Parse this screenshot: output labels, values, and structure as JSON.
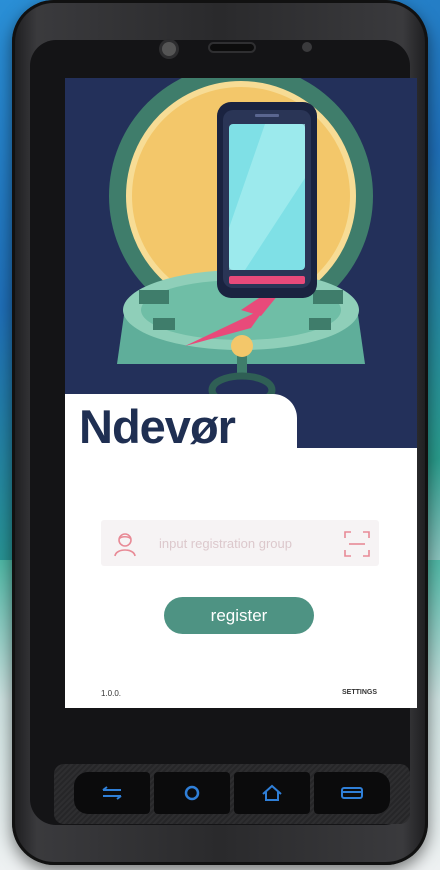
{
  "app": {
    "logo_text": "Ndevor",
    "logo_part1": "Ndev",
    "logo_part2": "ø",
    "logo_part3": "r"
  },
  "registration": {
    "placeholder": "input registration group",
    "value": ""
  },
  "buttons": {
    "register_label": "register"
  },
  "footer": {
    "version": "1.0.0.",
    "settings_label": "SETTINGS"
  },
  "navigation": {
    "buttons": [
      "switch-apps",
      "home-circle",
      "home",
      "menu"
    ]
  },
  "colors": {
    "brand_navy": "#1f2f52",
    "register_green": "#4e9383",
    "hero_background": "#23305a",
    "icon_pink": "#e88a96",
    "nav_icon_blue": "#2f7fd8"
  }
}
